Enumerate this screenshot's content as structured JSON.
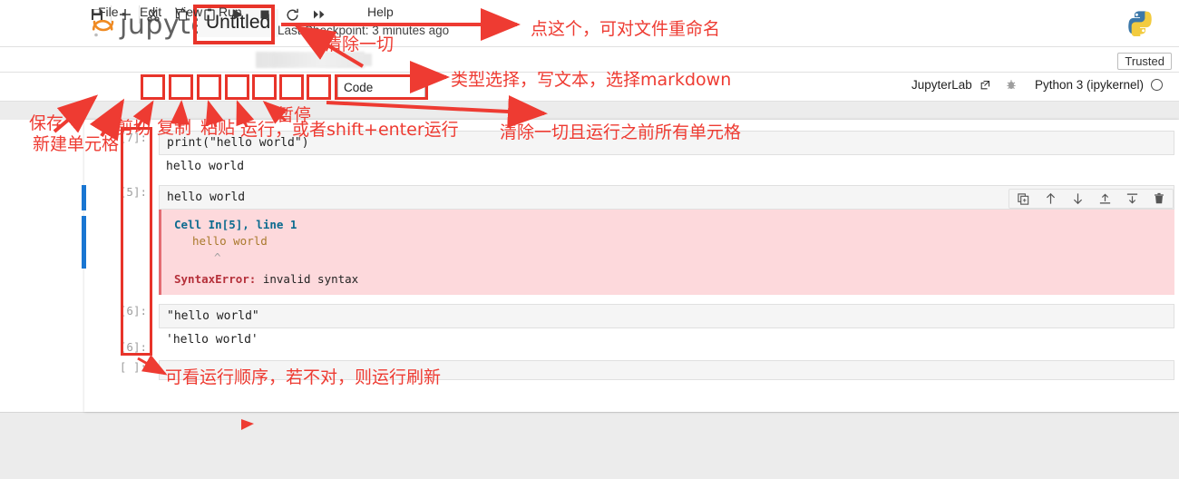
{
  "header": {
    "brand": "jupyter",
    "notebook_title": "Untitled",
    "checkpoint": "Last Checkpoint: 3 minutes ago",
    "python_logo": "python-logo",
    "trusted_badge": "Trusted"
  },
  "menubar": {
    "items": [
      {
        "label": "File"
      },
      {
        "label": "Edit"
      },
      {
        "label": "View"
      },
      {
        "label": "Run"
      },
      {
        "label": "Help"
      }
    ]
  },
  "toolbar": {
    "buttons": [
      {
        "name": "save-button",
        "icon": "save-icon"
      },
      {
        "name": "insert-cell-button",
        "icon": "plus-icon"
      },
      {
        "name": "cut-button",
        "icon": "scissors-icon"
      },
      {
        "name": "copy-button",
        "icon": "copy-icon"
      },
      {
        "name": "paste-button",
        "icon": "clipboard-icon"
      },
      {
        "name": "run-button",
        "icon": "play-icon"
      },
      {
        "name": "interrupt-button",
        "icon": "stop-icon"
      },
      {
        "name": "restart-button",
        "icon": "restart-icon"
      },
      {
        "name": "restart-run-all-button",
        "icon": "fast-forward-icon"
      }
    ],
    "cell_type": "Code",
    "chevron": "⌄",
    "jupyterlab_link": "JupyterLab",
    "external_link_icon": "external-link-icon",
    "debug_icon": "bug-icon",
    "kernel_name": "Python 3 (ipykernel)",
    "kernel_status_icon": "kernel-idle-circle"
  },
  "cell_toolbar": {
    "icons": [
      {
        "name": "duplicate-cell-icon"
      },
      {
        "name": "move-cell-up-icon"
      },
      {
        "name": "move-cell-down-icon"
      },
      {
        "name": "insert-cell-above-icon"
      },
      {
        "name": "insert-cell-below-icon"
      },
      {
        "name": "delete-cell-icon"
      }
    ]
  },
  "notebook": {
    "cells": [
      {
        "prompt": "[7]:",
        "source": "print(\"hello world\")",
        "output_type": "stream",
        "output": "hello world"
      },
      {
        "prompt": "[5]:",
        "source": "hello world",
        "output_type": "error",
        "error": {
          "location": "Cell In[5], line 1",
          "source_line": "hello world",
          "caret": "^",
          "name": "SyntaxError:",
          "message": " invalid syntax"
        },
        "selected": true
      },
      {
        "prompt": "[6]:",
        "source": "\"hello world\"",
        "output_type": "result",
        "output_prompt": "[6]:",
        "output": "'hello world'"
      },
      {
        "prompt": "[ ]:",
        "source": "",
        "output_type": "none"
      }
    ]
  },
  "annotations": [
    {
      "name": "annotation-rename-file",
      "text": "点这个，可对文件重命名"
    },
    {
      "name": "annotation-clear-all",
      "text": "清除一切"
    },
    {
      "name": "annotation-cell-type",
      "text": "类型选择，写文本，选择markdown"
    },
    {
      "name": "annotation-save",
      "text": "保存"
    },
    {
      "name": "annotation-new-cell",
      "text": "新建单元格"
    },
    {
      "name": "annotation-cut",
      "text": "剪切"
    },
    {
      "name": "annotation-copy",
      "text": "复制"
    },
    {
      "name": "annotation-paste",
      "text": "粘贴"
    },
    {
      "name": "annotation-run",
      "text": "运行，或者shift+enter运行"
    },
    {
      "name": "annotation-pause",
      "text": "暂停"
    },
    {
      "name": "annotation-restart-run-all",
      "text": "清除一切且运行之前所有单元格"
    },
    {
      "name": "annotation-exec-order",
      "text": "可看运行顺序，若不对，则运行刷新"
    }
  ],
  "colors": {
    "annotation_red": "#ee3b32",
    "highlight_red": "#e8342a",
    "selection_blue": "#1976d2",
    "error_bg": "#fdd9dc"
  }
}
